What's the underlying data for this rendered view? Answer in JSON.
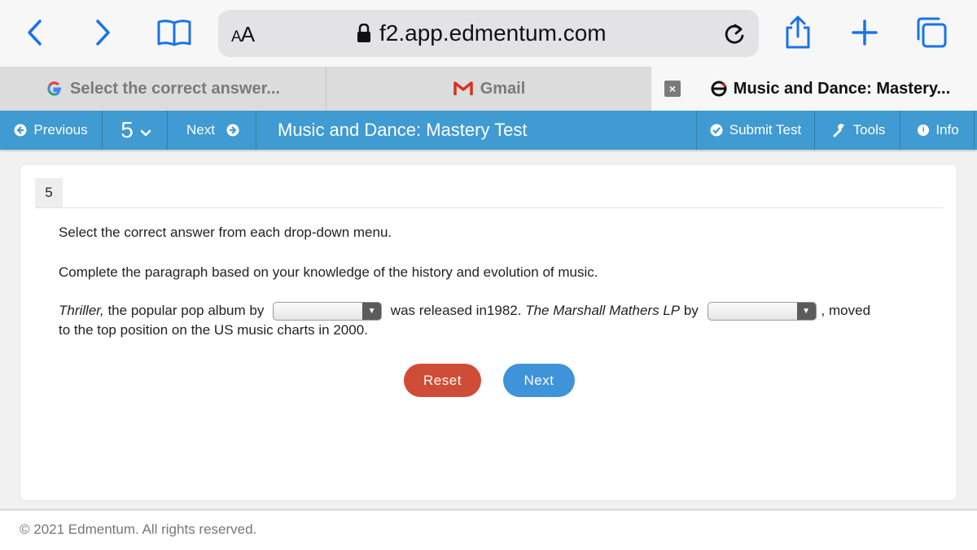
{
  "browser": {
    "text_size_label": "AA",
    "url": "f2.app.edmentum.com"
  },
  "tabs": [
    {
      "label": "Select the correct answer...",
      "icon": "google-icon"
    },
    {
      "label": "Gmail",
      "icon": "gmail-icon"
    },
    {
      "label": "Music and Dance: Mastery...",
      "icon": "edmentum-icon",
      "active": true
    }
  ],
  "testbar": {
    "previous_label": "Previous",
    "question_selector": "5",
    "next_label": "Next",
    "title": "Music and Dance: Mastery Test",
    "submit_label": "Submit Test",
    "tools_label": "Tools",
    "info_label": "Info"
  },
  "question": {
    "number": "5",
    "instruction": "Select the correct answer from each drop-down menu.",
    "prompt": "Complete the paragraph based on your knowledge of the history and evolution of music.",
    "sentence": {
      "part1_italic": "Thriller,",
      "part1": " the popular pop album by",
      "part2": "was released in1982.",
      "part3_italic": "The Marshall Mathers LP",
      "part3": "by",
      "part4": ", moved",
      "line2": "to the top position on the US music charts in 2000."
    },
    "dropdown1_value": "",
    "dropdown2_value": ""
  },
  "buttons": {
    "reset_label": "Reset",
    "next_label": "Next"
  },
  "footer": {
    "copyright": "© 2021 Edmentum. All rights reserved."
  },
  "colors": {
    "toolbar_blue": "#3f9bd1",
    "reset_red": "#cf4d36",
    "next_blue": "#3e93d9",
    "safari_blue": "#1a73e8"
  }
}
